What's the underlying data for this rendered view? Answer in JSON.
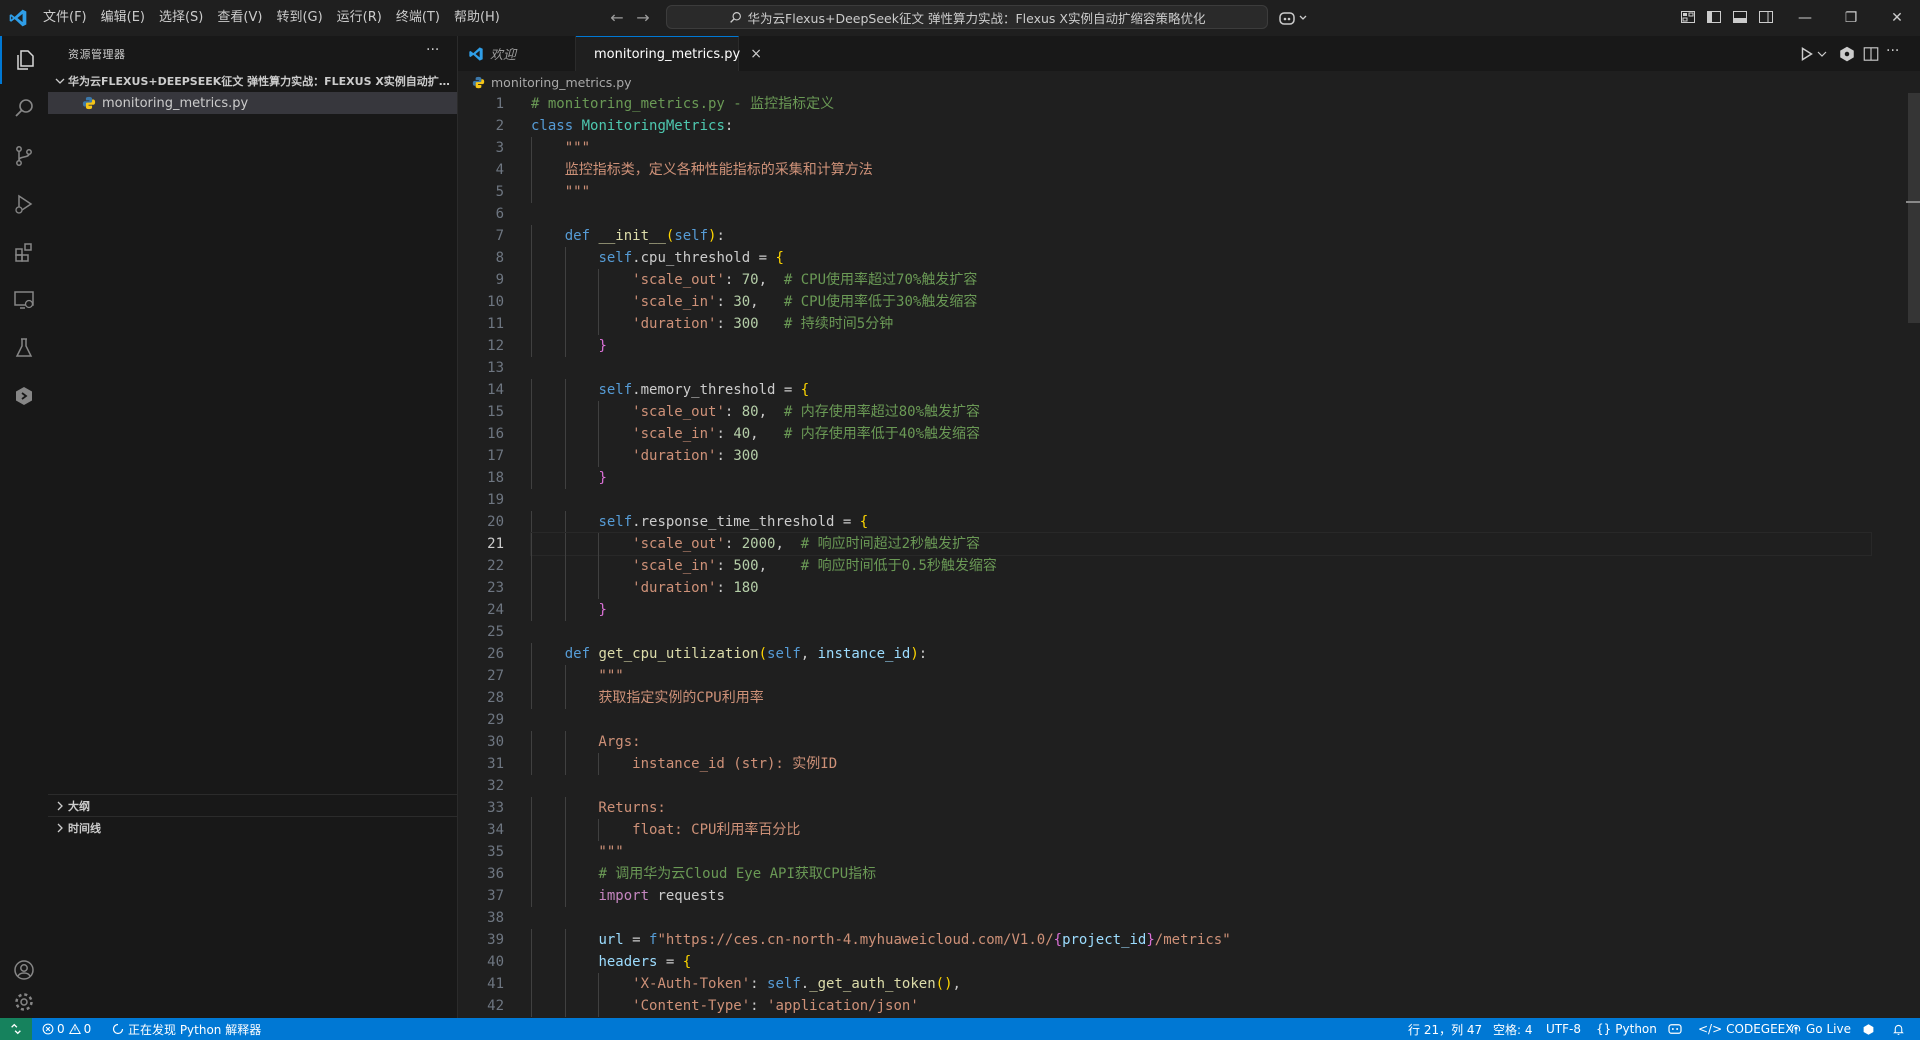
{
  "menu": [
    "文件(F)",
    "编辑(E)",
    "选择(S)",
    "查看(V)",
    "转到(G)",
    "运行(R)",
    "终端(T)",
    "帮助(H)"
  ],
  "command_center": {
    "text": "华为云Flexus+DeepSeek征文 弹性算力实战：Flexus X实例自动扩缩容策略优化"
  },
  "sidebar": {
    "title": "资源管理器",
    "more": "···",
    "folder": "华为云FLEXUS+DEEPSEEK征文 弹性算力实战：FLEXUS X实例自动扩缩容策略优化",
    "file": "monitoring_metrics.py",
    "outline": "大纲",
    "timeline": "时间线"
  },
  "tabs": {
    "welcome": "欢迎",
    "active": "monitoring_metrics.py",
    "close": "×"
  },
  "breadcrumb": "monitoring_metrics.py",
  "editor": {
    "active_line": 21,
    "line_numbers": [
      1,
      2,
      3,
      4,
      5,
      6,
      7,
      8,
      9,
      10,
      11,
      12,
      13,
      14,
      15,
      16,
      17,
      18,
      19,
      20,
      21,
      22,
      23,
      24,
      25,
      26,
      27,
      28,
      29,
      30,
      31,
      32,
      33,
      34,
      35,
      36,
      37,
      38,
      39,
      40,
      41,
      42
    ],
    "lines": [
      "# monitoring_metrics.py - 监控指标定义",
      "class MonitoringMetrics:",
      "    \"\"\"",
      "    监控指标类，定义各种性能指标的采集和计算方法",
      "    \"\"\"",
      "",
      "    def __init__(self):",
      "        self.cpu_threshold = {",
      "            'scale_out': 70,  # CPU使用率超过70%触发扩容",
      "            'scale_in': 30,   # CPU使用率低于30%触发缩容",
      "            'duration': 300   # 持续时间5分钟",
      "        }",
      "",
      "        self.memory_threshold = {",
      "            'scale_out': 80,  # 内存使用率超过80%触发扩容",
      "            'scale_in': 40,   # 内存使用率低于40%触发缩容",
      "            'duration': 300",
      "        }",
      "",
      "        self.response_time_threshold = {",
      "            'scale_out': 2000,  # 响应时间超过2秒触发扩容",
      "            'scale_in': 500,    # 响应时间低于0.5秒触发缩容",
      "            'duration': 180",
      "        }",
      "",
      "    def get_cpu_utilization(self, instance_id):",
      "        \"\"\"",
      "        获取指定实例的CPU利用率",
      "",
      "        Args:",
      "            instance_id (str): 实例ID",
      "",
      "        Returns:",
      "            float: CPU利用率百分比",
      "        \"\"\"",
      "        # 调用华为云Cloud Eye API获取CPU指标",
      "        import requests",
      "",
      "        url = f\"https://ces.cn-north-4.myhuaweicloud.com/V1.0/{project_id}/metrics\"",
      "        headers = {",
      "            'X-Auth-Token': self._get_auth_token(),",
      "            'Content-Type': 'application/json'"
    ]
  },
  "status": {
    "errors": "0",
    "warnings": "0",
    "python_discovery": "正在发现 Python 解释器",
    "position": "行 21，列 47",
    "spaces": "空格: 4",
    "encoding": "UTF-8",
    "language": "Python",
    "codegeex": "CODEGEEX",
    "golive": "Go Live"
  },
  "colors": {
    "accent": "#0078d4",
    "remote": "#16825d"
  }
}
